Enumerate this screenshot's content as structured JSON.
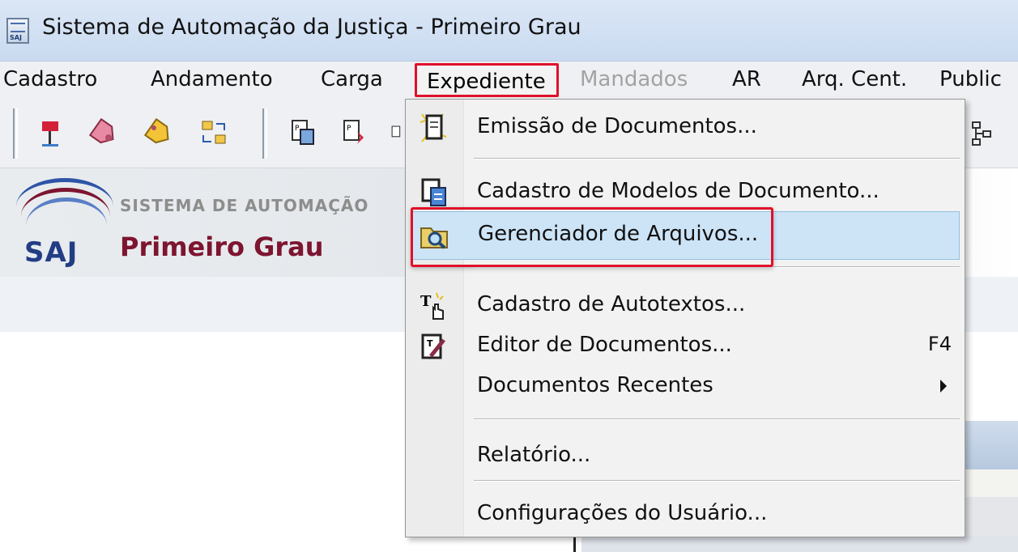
{
  "window": {
    "title": "Sistema de Automação da Justiça - Primeiro Grau",
    "icon_label": "SAJ"
  },
  "menubar": {
    "items": [
      {
        "label": "Cadastro",
        "enabled": true
      },
      {
        "label": "Andamento",
        "enabled": true
      },
      {
        "label": "Carga",
        "enabled": true
      },
      {
        "label": "Expediente",
        "enabled": true,
        "open": true
      },
      {
        "label": "Mandados",
        "enabled": false
      },
      {
        "label": "AR",
        "enabled": true
      },
      {
        "label": "Arq. Cent.",
        "enabled": true
      },
      {
        "label": "Public",
        "enabled": true
      }
    ]
  },
  "toolbar": {
    "icons": [
      "flag-icon",
      "tag-pink-icon",
      "tag-yellow-icon",
      "transfer-icon",
      "document-p-icon",
      "document-p-red-icon",
      "document-p-partial-icon",
      "org-chart-icon"
    ]
  },
  "banner": {
    "logo": "SAJ",
    "system_line": "SISTEMA DE AUTOMAÇÃO",
    "subtitle": "Primeiro Grau"
  },
  "dropdown": {
    "items": [
      {
        "label": "Emissão de Documentos...",
        "icon": "document-star-icon"
      },
      {
        "label": "Cadastro de Modelos de Documento...",
        "icon": "document-model-icon"
      },
      {
        "label": "Gerenciador de Arquivos...",
        "icon": "folder-search-icon",
        "highlighted": true
      },
      {
        "label": "Cadastro de Autotextos...",
        "icon": "autotext-icon"
      },
      {
        "label": "Editor de Documentos...",
        "icon": "editor-icon",
        "shortcut": "F4"
      },
      {
        "label": "Documentos Recentes",
        "icon": "",
        "submenu": true
      },
      {
        "label": "Relatório...",
        "icon": ""
      },
      {
        "label": "Configurações do Usuário...",
        "icon": ""
      }
    ]
  },
  "colors": {
    "highlight_box": "#e0102a",
    "hover_bg": "#cde4f7",
    "subtitle": "#7d1530",
    "logo": "#233d85"
  }
}
